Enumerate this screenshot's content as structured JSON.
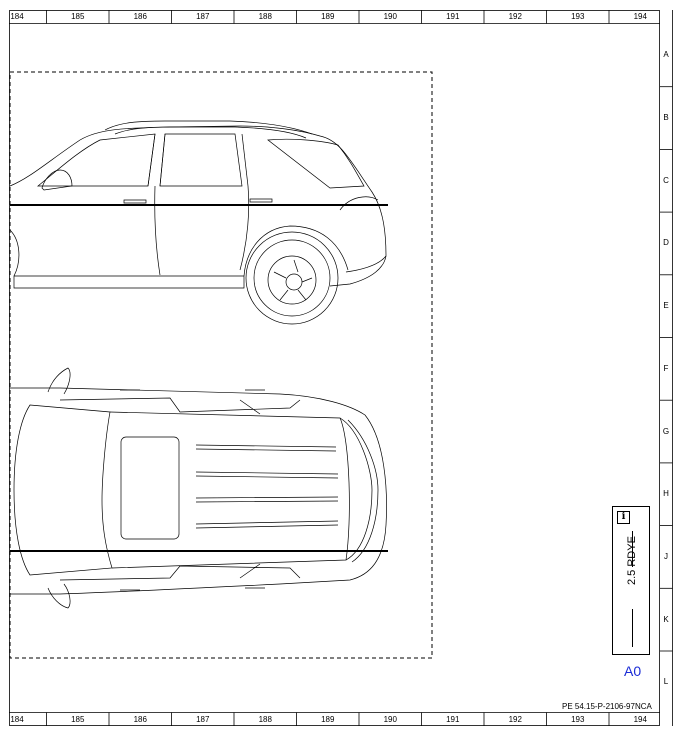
{
  "ruler": {
    "columns": [
      "184",
      "185",
      "186",
      "187",
      "188",
      "189",
      "190",
      "191",
      "192",
      "193",
      "194"
    ],
    "rows": [
      "A",
      "B",
      "C",
      "D",
      "E",
      "F",
      "G",
      "H",
      "J",
      "K",
      "L"
    ]
  },
  "legend": {
    "icon": "info-icon",
    "wire_label": "2.5 RDYE"
  },
  "connector_code": "A0",
  "doc_ref": "PE 54.15-P-2106-97NCA",
  "colors": {
    "line": "#000000",
    "connector_code": "#1a2bd6"
  }
}
